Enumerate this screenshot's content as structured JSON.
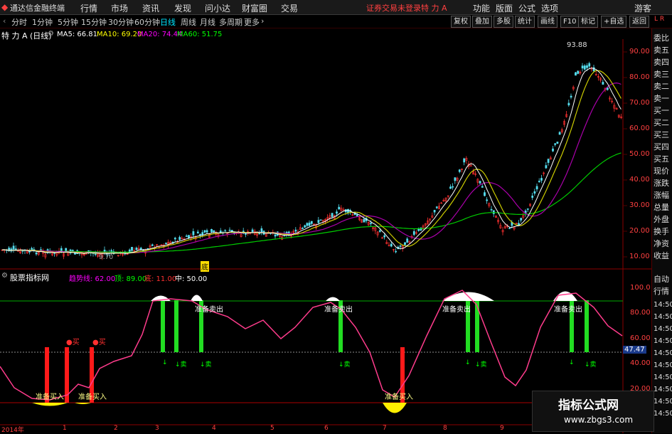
{
  "menu": {
    "app_title": "通达信金融终端",
    "items": [
      "行情",
      "市场",
      "资讯",
      "发现",
      "问小达",
      "财富圈",
      "交易"
    ],
    "notice": "证券交易未登录",
    "stock": "特 力 A",
    "right_items": [
      "功能",
      "版面",
      "公式",
      "选项"
    ],
    "guest": "游客"
  },
  "timeframes": [
    "分时",
    "1分钟",
    "5分钟",
    "15分钟",
    "30分钟",
    "60分钟",
    "日线",
    "周线",
    "月线",
    "多周期",
    "更多"
  ],
  "active_timeframe": "日线",
  "tools": [
    "复权",
    "叠加",
    "多股",
    "统计",
    "画线",
    "F10",
    "标记",
    "+自选",
    "返回"
  ],
  "main_chart": {
    "title": "特 力 A (日线)",
    "ma_labels": [
      {
        "text": "MA5: 66.81",
        "color": "#ffffff"
      },
      {
        "text": "MA10: 69.20",
        "color": "#ffff00"
      },
      {
        "text": "MA20: 74.44",
        "color": "#ff00ff"
      },
      {
        "text": "MA60: 51.75",
        "color": "#00ff00"
      }
    ],
    "price_labels": [
      "90.00",
      "80.00",
      "70.00",
      "60.00",
      "50.00",
      "40.00",
      "30.00",
      "20.00",
      "10.00"
    ],
    "high_label": "93.88",
    "low_label": "9.70",
    "marker": "底",
    "current_price": "70.00"
  },
  "indicator": {
    "title": "股票指标网",
    "params": [
      {
        "text": "趋势线: 62.00",
        "color": "#ff00ff"
      },
      {
        "text": "顶: 89.00",
        "color": "#00ff00"
      },
      {
        "text": "底: 11.00",
        "color": "#ff0000"
      },
      {
        "text": "中: 50.00",
        "color": "#ffffff"
      }
    ],
    "y_labels": [
      "100.0",
      "80.00",
      "60.00",
      "40.00",
      "20.00"
    ],
    "current_value": "47.47",
    "buy_ready": "准备买入",
    "sell_ready": "准备卖出",
    "buy": "买",
    "sell": "卖"
  },
  "right_panel": {
    "labels": [
      "委比",
      "卖五",
      "卖四",
      "卖三",
      "卖二",
      "卖一",
      "买一",
      "买二",
      "买三",
      "买四",
      "买五",
      "现价",
      "涨跌",
      "涨幅",
      "总量",
      "外盘",
      "换手",
      "净资",
      "收益",
      "自动",
      "行情"
    ],
    "times": [
      "14:50",
      "14:50",
      "14:50",
      "14:50",
      "14:50",
      "14:50",
      "14:50",
      "14:50",
      "14:50",
      "14:50"
    ]
  },
  "x_axis": [
    "2014年",
    "1",
    "2",
    "3",
    "4",
    "5",
    "6",
    "7",
    "8",
    "9"
  ],
  "watermark": {
    "title": "指标公式网",
    "url": "www.zbgs3.com"
  }
}
